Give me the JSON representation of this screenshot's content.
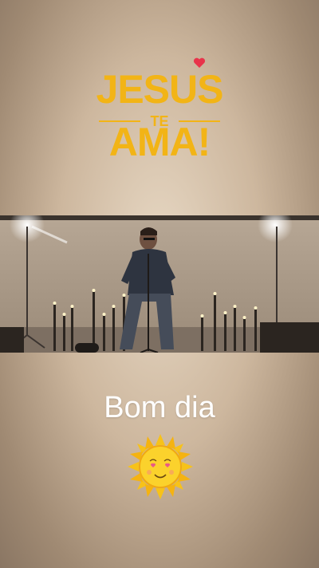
{
  "logo": {
    "line1": "JESUS",
    "line2": "TE",
    "line3": "AMA!",
    "color": "#f2b416",
    "heart_color": "#e8334a"
  },
  "video": {
    "description_icon": "singer-on-stage-with-candles"
  },
  "greeting": "Bom dia",
  "emoji": "sun-with-heart-eyes-icon"
}
